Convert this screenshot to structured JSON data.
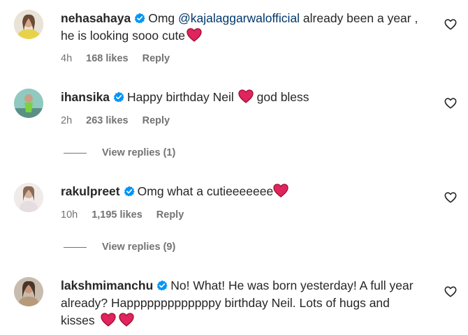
{
  "comments": [
    {
      "username": "nehasahaya",
      "text_before": "Omg ",
      "mention": "@kajalaggarwalofficial",
      "text_after": " already been a year , he is looking sooo cute",
      "time": "4h",
      "likes": "168 likes",
      "reply": "Reply"
    },
    {
      "username": "ihansika",
      "text_before": "Happy birthday Neil",
      "text_after": " god bless",
      "time": "2h",
      "likes": "263 likes",
      "reply": "Reply",
      "view_replies": "View replies (1)"
    },
    {
      "username": "rakulpreet",
      "text_before": "Omg what a cutieeeeeee",
      "time": "10h",
      "likes": "1,195 likes",
      "reply": "Reply",
      "view_replies": "View replies (9)"
    },
    {
      "username": "lakshmimanchu",
      "text_before": "No! What! He was born yesterday! A full year already? Happpppppppppppy birthday Neil. Lots of hugs and kisses"
    }
  ],
  "icons": {
    "verified": "verified-badge-icon",
    "heart_emoji": "red-heart-emoji",
    "like": "heart-outline-icon"
  },
  "colors": {
    "verified": "#0095f6",
    "heart": "#e0245e",
    "mention": "#00376b",
    "meta": "#737373"
  }
}
